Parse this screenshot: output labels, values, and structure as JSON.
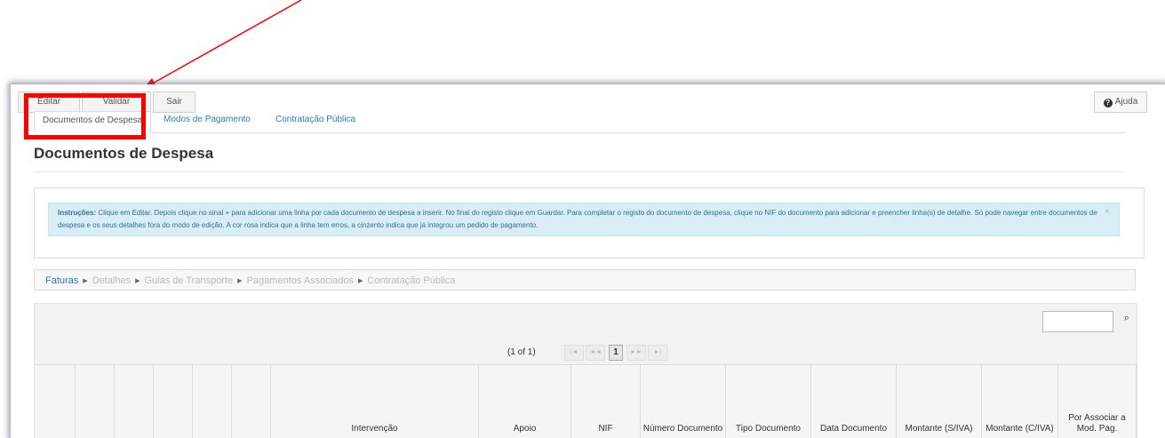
{
  "toolbar": {
    "b1": "Editar",
    "b2": "Validar",
    "b3": "Sair",
    "help": "Ajuda"
  },
  "tabs": [
    "Documentos de Despesa",
    "Modos de Pagamento",
    "Contratação Pública"
  ],
  "page_title": "Documentos de Despesa",
  "instructions": {
    "label": "Instruções:",
    "text": " Clique em Editar. Depois clique no sinal + para adicionar uma linha por cada documento de despesa a inserir. No final do registo clique em Guardar. Para completar o registo do documento de despesa, clique no NIF do documento para adicionar e preencher linha(s) de detalhe. Só pode navegar entre documentos de despesa e os seus detalhes fora do modo de edição. A cor rosa indica que a linha tem erros, a cinzento indica que já integrou um pedido de pagamento.",
    "close": "×"
  },
  "breadcrumb": [
    "Faturas",
    "Detalhes",
    "Guias de Transporte",
    "Pagamentos Associados",
    "Contratação Pública"
  ],
  "pager": {
    "label": "(1 of 1)",
    "first": "|◄",
    "prev": "◄◄",
    "page": "1",
    "next": "►►",
    "last": "►|"
  },
  "table": {
    "columns": [
      "",
      "",
      "",
      "",
      "",
      "",
      "Intervenção",
      "Apoio",
      "NIF",
      "Número Documento",
      "Tipo Documento",
      "Data Documento",
      "Montante (S/IVA)",
      "Montante (C/IVA)",
      "Por Associar a Mod. Pag."
    ]
  },
  "colors": {
    "link": "#2a7bbf",
    "annotation": "#ff0000",
    "alert_bg": "#d9edf7"
  }
}
